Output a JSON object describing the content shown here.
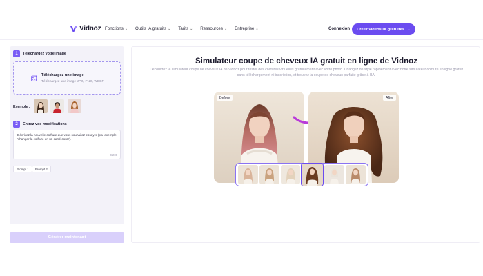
{
  "brand": {
    "name": "Vidnoz",
    "accent": "#6b4cf0"
  },
  "nav": {
    "items": [
      {
        "label": "Fonctions"
      },
      {
        "label": "Outils IA gratuits"
      },
      {
        "label": "Tarifs"
      },
      {
        "label": "Ressources"
      },
      {
        "label": "Entreprise"
      }
    ],
    "login": "Connexion",
    "cta": "Créez vidéos IA gratuites",
    "cta_arrow": "→"
  },
  "left_panel": {
    "step1": {
      "num": "1",
      "label": "Téléchargez votre image"
    },
    "upload": {
      "title": "Téléchargez une image",
      "subtitle": "Téléchargez une image JPG, PNG, WEBP"
    },
    "examples_label": "Exemple :",
    "step2": {
      "num": "2",
      "label": "Entrez vos modifications"
    },
    "prompt": {
      "text": "Décrivez la nouvelle coiffure que vous souhaitez essayer (par exemple, 'changer la coiffure en un carré court').",
      "counter": "0/200"
    },
    "chips": [
      "Prompt 1",
      "Prompt 2"
    ],
    "generate": "Générer maintenant"
  },
  "main": {
    "title": "Simulateur coupe de cheveux IA gratuit en ligne de Vidnoz",
    "description": "Découvrez le simulateur coupe de cheveux IA de Vidnoz pour tester des coiffures virtuelles gratuitement avec votre photo. Changez de style rapidement avec notre simulateur coiffure en ligne gratuit sans téléchargement ni inscription, et trouvez la coupe de cheveux parfaite grâce à l'IA.",
    "before_label": "Before",
    "after_label": "After"
  }
}
